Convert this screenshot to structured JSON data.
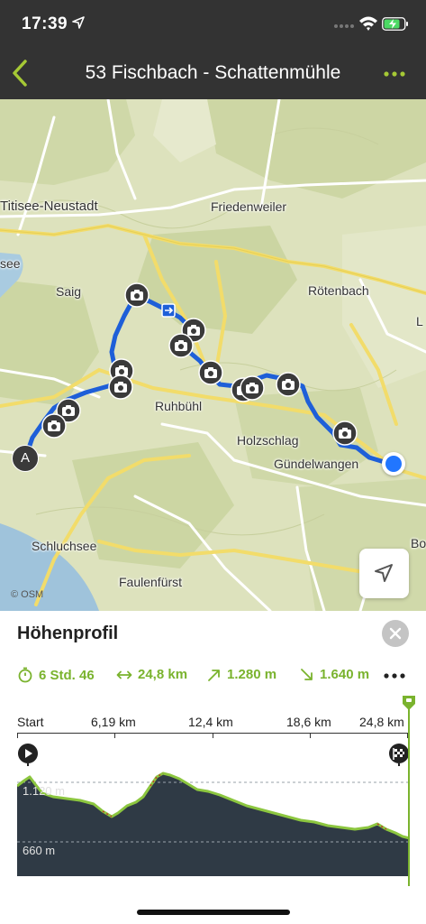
{
  "status_bar": {
    "time": "17:39",
    "location_icon": "location-arrow-icon",
    "wifi_icon": "wifi-icon",
    "battery_icon": "battery-charging-icon"
  },
  "nav": {
    "back_icon": "chevron-left-icon",
    "title": "53 Fischbach - Schattenmühle",
    "more_icon": "more-dots-icon",
    "accent_color": "#a6c935"
  },
  "map": {
    "place_labels": {
      "titisee": "Titisee-Neustadt",
      "friedenweiler": "Friedenweiler",
      "see": "see",
      "saig": "Saig",
      "roetenbach": "Rötenbach",
      "l_edge": "L",
      "ruhbuehl": "Ruhbühl",
      "holzschlag": "Holzschlag",
      "guendelwangen": "Gündelwangen",
      "schluchsee": "Schluchsee",
      "bo_edge": "Bo",
      "faulenfuerst": "Faulenfürst"
    },
    "start_marker": "A",
    "attribution": "© OSM",
    "route_color": "#1e5fd8",
    "photo_icon": "camera-icon",
    "locate_icon": "navigation-arrow-icon"
  },
  "panel": {
    "title": "Höhenprofil",
    "close_icon": "close-icon",
    "accent_color": "#7ab32e",
    "stats": {
      "duration": "6 Std. 46",
      "distance": "24,8 km",
      "ascent": "1.280 m",
      "descent": "1.640 m"
    },
    "stats_more_icon": "more-dots-icon",
    "axis": {
      "labels": [
        "Start",
        "6,19 km",
        "12,4 km",
        "18,6 km",
        "24,8 km"
      ]
    },
    "elevation": {
      "upper_label": "1.120 m",
      "lower_label": "660 m",
      "start_icon": "play-icon",
      "end_icon": "finish-flag-icon"
    }
  }
}
